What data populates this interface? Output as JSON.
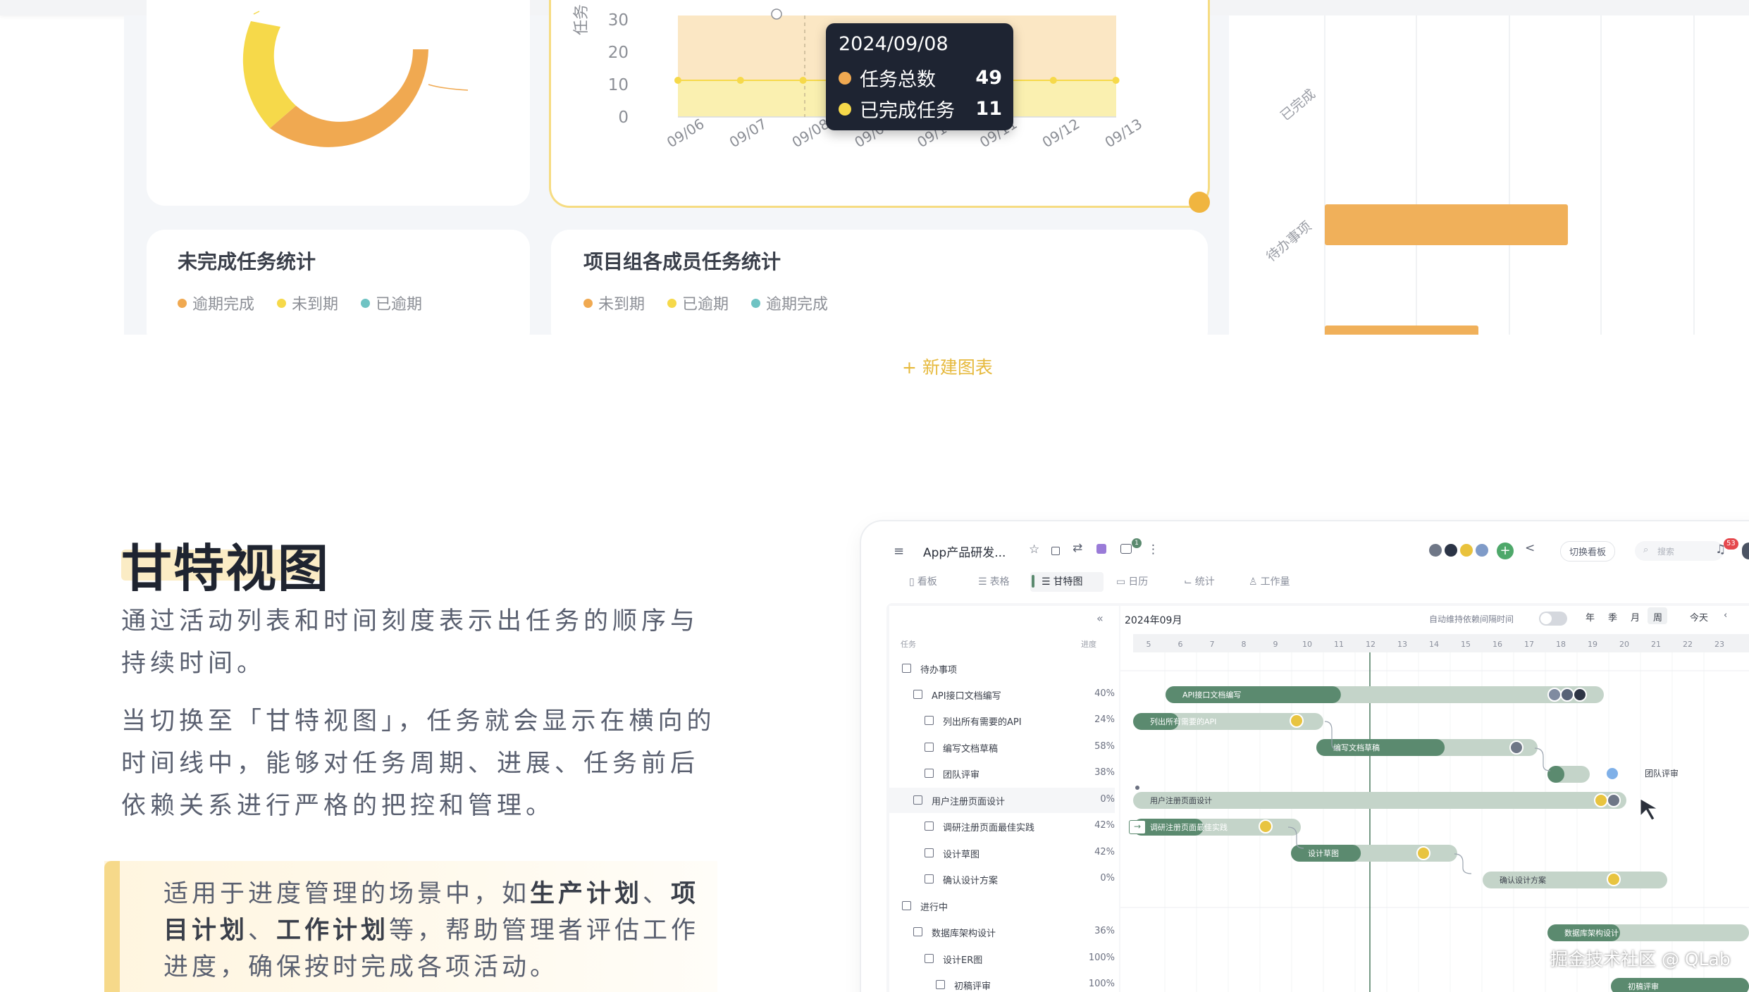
{
  "dashboard": {
    "line_chart": {
      "y_ticks": [
        "30",
        "20",
        "10",
        "0"
      ],
      "x_ticks": [
        "09/06",
        "09/07",
        "09/08",
        "09/09",
        "09/10",
        "09/11",
        "09/12",
        "09/13"
      ],
      "ylabel": "任务"
    },
    "tooltip": {
      "date": "2024/09/08",
      "rows": [
        {
          "label": "任务总数",
          "value": "49",
          "color": "#f0a951"
        },
        {
          "label": "已完成任务",
          "value": "11",
          "color": "#f6d94a"
        }
      ]
    },
    "right_chart": {
      "category_labels": [
        "已完成",
        "待办事项"
      ]
    },
    "card_unfinished": {
      "title": "未完成任务统计",
      "legend": [
        {
          "label": "逾期完成",
          "color": "#f0a951"
        },
        {
          "label": "未到期",
          "color": "#f6d94a"
        },
        {
          "label": "已逾期",
          "color": "#6fc3c3"
        }
      ]
    },
    "card_members": {
      "title": "项目组各成员任务统计",
      "legend": [
        {
          "label": "未到期",
          "color": "#f0a951"
        },
        {
          "label": "已逾期",
          "color": "#f6d94a"
        },
        {
          "label": "逾期完成",
          "color": "#6fc3c3"
        }
      ]
    },
    "new_chart_label": "+ 新建图表"
  },
  "feature": {
    "title": "甘特视图",
    "para1": "通过活动列表和时间刻度表示出任务的顺序与持续时间。",
    "para2": "当切换至「甘特视图」，任务就会显示在横向的时间线中，能够对任务周期、进展、任务前后依赖关系进行严格的把控和管理。",
    "callout": {
      "t1": "适用于进度管理的场景中，如",
      "b1": "生产计划",
      "t2": "、",
      "b2": "项目计划",
      "t3": "、",
      "b3": "工作计划",
      "t4": "等，帮助管理者评估工作进度，确保按时完成各项活动。"
    }
  },
  "app": {
    "title": "App产品研发...",
    "badge_count": "1",
    "notif_count": "53",
    "switch_board": "切换看板",
    "search_placeholder": "搜索",
    "tabs": [
      "看板",
      "表格",
      "甘特图",
      "日历",
      "统计",
      "工作量"
    ],
    "month": "2024年09月",
    "auto_keep": "自动维持依赖间隔时间",
    "scales": [
      "年",
      "季",
      "月",
      "周"
    ],
    "today": "今天",
    "col_task": "任务",
    "col_progress": "进度",
    "days": [
      "5",
      "6",
      "7",
      "8",
      "9",
      "10",
      "11",
      "12",
      "13",
      "14",
      "15",
      "16",
      "17",
      "18",
      "19",
      "20",
      "21",
      "22",
      "23"
    ],
    "groups": [
      {
        "label": "待办事项"
      },
      {
        "label": "进行中"
      }
    ],
    "tasks": [
      {
        "label": "API接口文档编写",
        "progress": "40%",
        "level": 1
      },
      {
        "label": "列出所有需要的API",
        "progress": "24%",
        "level": 2
      },
      {
        "label": "编写文档草稿",
        "progress": "58%",
        "level": 2
      },
      {
        "label": "团队评审",
        "progress": "38%",
        "level": 2
      },
      {
        "label": "用户注册页面设计",
        "progress": "0%",
        "level": 1
      },
      {
        "label": "调研注册页面最佳实践",
        "progress": "42%",
        "level": 2
      },
      {
        "label": "设计草图",
        "progress": "42%",
        "level": 2
      },
      {
        "label": "确认设计方案",
        "progress": "0%",
        "level": 2
      },
      {
        "label": "数据库架构设计",
        "progress": "36%",
        "level": 1
      },
      {
        "label": "设计ER图",
        "progress": "100%",
        "level": 2
      },
      {
        "label": "初稿评审",
        "progress": "100%",
        "level": 3
      }
    ],
    "bars": [
      {
        "label": "API接口文档编写",
        "progress": 0.4
      },
      {
        "label": "列出所有需要的API",
        "progress": 0.24
      },
      {
        "label": "编写文档草稿",
        "progress": 0.58
      },
      {
        "label": "团队评审",
        "progress": 0.38
      },
      {
        "label": "用户注册页面设计",
        "progress": 0.0
      },
      {
        "label": "调研注册页面最佳实践",
        "progress": 0.42
      },
      {
        "label": "设计草图",
        "progress": 0.42
      },
      {
        "label": "确认设计方案",
        "progress": 0.0
      },
      {
        "label": "数据库架构设计",
        "progress": 0.36
      },
      {
        "label": "初稿评审",
        "progress": 1.0
      }
    ],
    "side_label": "团队评审"
  },
  "watermark": "掘金技术社区 @ QLab"
}
